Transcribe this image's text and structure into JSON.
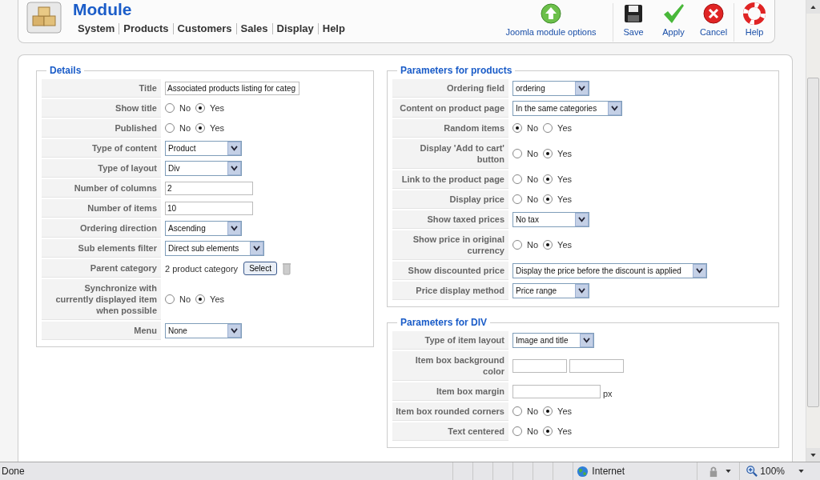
{
  "header": {
    "title": "Module",
    "menu": [
      "System",
      "Products",
      "Customers",
      "Sales",
      "Display",
      "Help"
    ],
    "toolbar": [
      {
        "label": "Joomla module options",
        "kind": "options"
      },
      {
        "label": "Save",
        "kind": "save"
      },
      {
        "label": "Apply",
        "kind": "apply"
      },
      {
        "label": "Cancel",
        "kind": "cancel"
      },
      {
        "label": "Help",
        "kind": "help"
      }
    ]
  },
  "details": {
    "legend": "Details",
    "rows": [
      {
        "label": "Title",
        "kind": "text",
        "value": "Associated products listing for categ"
      },
      {
        "label": "Show title",
        "kind": "radio",
        "options": [
          {
            "label": "No",
            "selected": false
          },
          {
            "label": "Yes",
            "selected": true
          }
        ]
      },
      {
        "label": "Published",
        "kind": "radio",
        "options": [
          {
            "label": "No",
            "selected": false
          },
          {
            "label": "Yes",
            "selected": true
          }
        ]
      },
      {
        "label": "Type of content",
        "kind": "select",
        "value": "Product"
      },
      {
        "label": "Type of layout",
        "kind": "select",
        "value": "Div"
      },
      {
        "label": "Number of columns",
        "kind": "text",
        "value": "2"
      },
      {
        "label": "Number of items",
        "kind": "text",
        "value": "10"
      },
      {
        "label": "Ordering direction",
        "kind": "select",
        "value": "Ascending"
      },
      {
        "label": "Sub elements filter",
        "kind": "select",
        "value": "Direct sub elements"
      },
      {
        "label": "Parent category",
        "kind": "category",
        "value": "2 product category",
        "button": "Select"
      },
      {
        "label": "Synchronize with currently displayed item when possible",
        "kind": "radio",
        "options": [
          {
            "label": "No",
            "selected": false
          },
          {
            "label": "Yes",
            "selected": true
          }
        ]
      },
      {
        "label": "Menu",
        "kind": "select",
        "value": "None"
      }
    ]
  },
  "products": {
    "legend": "Parameters for products",
    "rows": [
      {
        "label": "Ordering field",
        "kind": "select",
        "value": "ordering"
      },
      {
        "label": "Content on product page",
        "kind": "select",
        "value": "In the same categories"
      },
      {
        "label": "Random items",
        "kind": "radio",
        "options": [
          {
            "label": "No",
            "selected": true
          },
          {
            "label": "Yes",
            "selected": false
          }
        ]
      },
      {
        "label": "Display 'Add to cart' button",
        "kind": "radio",
        "options": [
          {
            "label": "No",
            "selected": false
          },
          {
            "label": "Yes",
            "selected": true
          }
        ]
      },
      {
        "label": "Link to the product page",
        "kind": "radio",
        "options": [
          {
            "label": "No",
            "selected": false
          },
          {
            "label": "Yes",
            "selected": true
          }
        ]
      },
      {
        "label": "Display price",
        "kind": "radio",
        "options": [
          {
            "label": "No",
            "selected": false
          },
          {
            "label": "Yes",
            "selected": true
          }
        ]
      },
      {
        "label": "Show taxed prices",
        "kind": "select",
        "value": "No tax"
      },
      {
        "label": "Show price in original currency",
        "kind": "radio",
        "options": [
          {
            "label": "No",
            "selected": false
          },
          {
            "label": "Yes",
            "selected": true
          }
        ]
      },
      {
        "label": "Show discounted price",
        "kind": "select",
        "value": "Display the price before the discount is applied"
      },
      {
        "label": "Price display method",
        "kind": "select",
        "value": "Price range"
      }
    ]
  },
  "div": {
    "legend": "Parameters for DIV",
    "rows": [
      {
        "label": "Type of item layout",
        "kind": "select",
        "value": "Image and title"
      },
      {
        "label": "Item box background color",
        "kind": "color_pair"
      },
      {
        "label": "Item box margin",
        "kind": "unit_input",
        "unit": "px"
      },
      {
        "label": "Item box rounded corners",
        "kind": "radio",
        "options": [
          {
            "label": "No",
            "selected": false
          },
          {
            "label": "Yes",
            "selected": true
          }
        ]
      },
      {
        "label": "Text centered",
        "kind": "radio",
        "options": [
          {
            "label": "No",
            "selected": false
          },
          {
            "label": "Yes",
            "selected": true
          }
        ]
      }
    ]
  },
  "status_bar": {
    "text": "Done",
    "zone": "Internet",
    "zoom": "100%"
  }
}
